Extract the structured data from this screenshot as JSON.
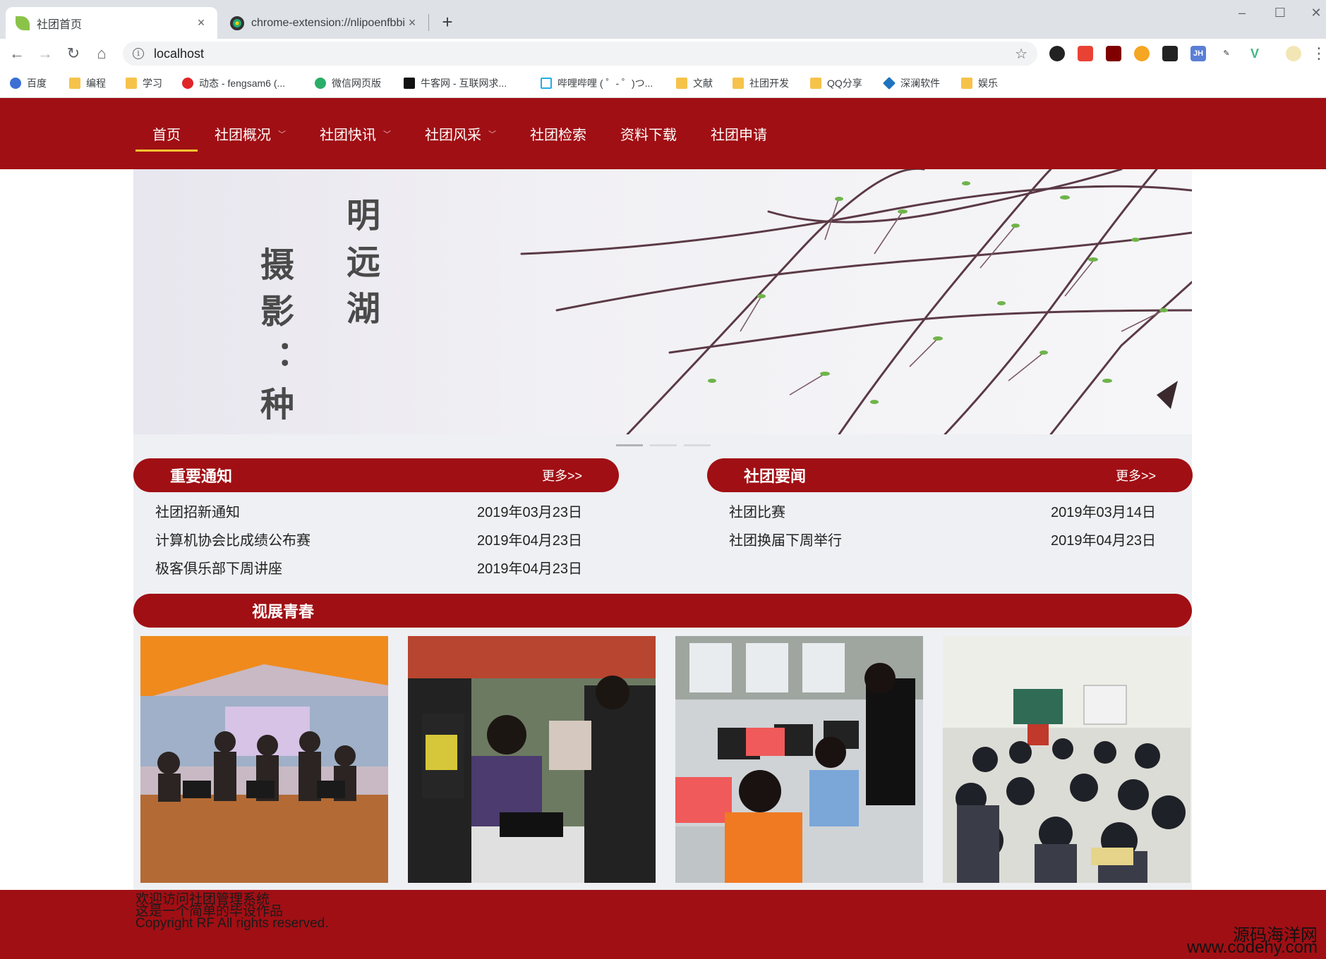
{
  "browser": {
    "tabs": [
      {
        "title": "社团首页",
        "close": "×"
      },
      {
        "title": "chrome-extension://nlipoenfbbikpbj",
        "close": "×"
      }
    ],
    "new_tab": "+",
    "url": "localhost",
    "bookmarks": [
      "百度",
      "编程",
      "学习",
      "动态 - fengsam6 (...",
      "微信网页版",
      "牛客网 - 互联网求...",
      "哔哩哔哩 ( ゜- ゜)つ...",
      "文献",
      "社团开发",
      "QQ分享",
      "深澜软件",
      "娱乐"
    ],
    "extensions": [
      "JH"
    ]
  },
  "nav": {
    "items": [
      {
        "label": "首页",
        "dropdown": false,
        "active": true
      },
      {
        "label": "社团概况",
        "dropdown": true
      },
      {
        "label": "社团快讯",
        "dropdown": true
      },
      {
        "label": "社团风采",
        "dropdown": true
      },
      {
        "label": "社团检索",
        "dropdown": false
      },
      {
        "label": "资料下载",
        "dropdown": false
      },
      {
        "label": "社团申请",
        "dropdown": false
      }
    ],
    "caret": "﹀"
  },
  "banner": {
    "poem_right": "明远湖",
    "poem_left": "摄影：种"
  },
  "notices": {
    "title": "重要通知",
    "more": "更多>>",
    "items": [
      {
        "text": "社团招新通知",
        "date": "2019年03月23日"
      },
      {
        "text": "计算机协会比成绩公布赛",
        "date": "2019年04月23日"
      },
      {
        "text": "极客俱乐部下周讲座",
        "date": "2019年04月23日"
      }
    ]
  },
  "news": {
    "title": "社团要闻",
    "more": "更多>>",
    "items": [
      {
        "text": "社团比赛",
        "date": "2019年03月14日"
      },
      {
        "text": "社团换届下周举行",
        "date": "2019年04月23日"
      }
    ]
  },
  "gallery": {
    "title": "视展青春"
  },
  "footer": {
    "line1": "欢迎访问社团管理系统",
    "line2": "这是一个简单的毕设作品",
    "line3": "Copyright RF All rights reserved."
  },
  "watermark": {
    "line1": "源码海洋网",
    "line2": "www.codehy.com"
  },
  "colors": {
    "brand_red": "#a00f14",
    "nav_underline": "#f2c230",
    "panel_bg": "#eef0f3"
  }
}
